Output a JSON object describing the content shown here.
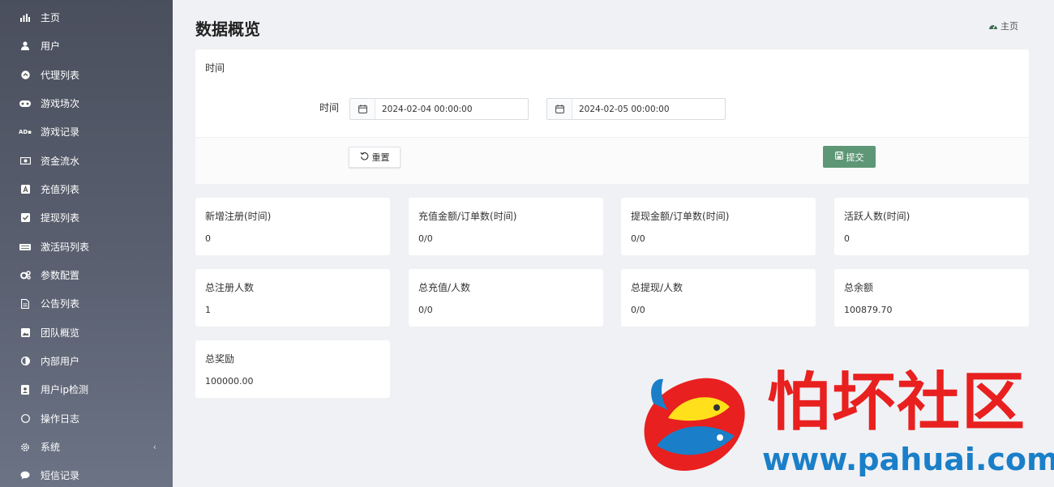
{
  "sidebar": {
    "items": [
      {
        "label": "主页",
        "icon": "bar-chart-icon"
      },
      {
        "label": "用户",
        "icon": "user-icon"
      },
      {
        "label": "代理列表",
        "icon": "circle-arrow-icon"
      },
      {
        "label": "游戏场次",
        "icon": "gamepad-icon"
      },
      {
        "label": "游戏记录",
        "icon": "ad-icon"
      },
      {
        "label": "资金流水",
        "icon": "money-icon"
      },
      {
        "label": "充值列表",
        "icon": "a-box-icon"
      },
      {
        "label": "提现列表",
        "icon": "check-square-icon"
      },
      {
        "label": "激活码列表",
        "icon": "keyboard-icon"
      },
      {
        "label": "参数配置",
        "icon": "gears-icon"
      },
      {
        "label": "公告列表",
        "icon": "file-text-icon"
      },
      {
        "label": "团队概览",
        "icon": "image-icon"
      },
      {
        "label": "内部用户",
        "icon": "half-circle-icon"
      },
      {
        "label": "用户ip检测",
        "icon": "id-card-icon"
      },
      {
        "label": "操作日志",
        "icon": "circle-outline-icon"
      },
      {
        "label": "系统",
        "icon": "gear-icon",
        "chevron": "‹"
      },
      {
        "label": "短信记录",
        "icon": "comment-icon"
      }
    ]
  },
  "header": {
    "title": "数据概览",
    "breadcrumb": "主页"
  },
  "filter": {
    "panel_title": "时间",
    "time_label": "时间",
    "start": "2024-02-04 00:00:00",
    "end": "2024-02-05 00:00:00",
    "reset_label": "重置",
    "submit_label": "提交"
  },
  "stats": [
    {
      "title": "新增注册(时间)",
      "value": "0"
    },
    {
      "title": "充值金额/订单数(时间)",
      "value": "0/0"
    },
    {
      "title": "提现金额/订单数(时间)",
      "value": "0/0"
    },
    {
      "title": "活跃人数(时间)",
      "value": "0"
    },
    {
      "title": "总注册人数",
      "value": "1"
    },
    {
      "title": "总充值/人数",
      "value": "0/0"
    },
    {
      "title": "总提现/人数",
      "value": "0/0"
    },
    {
      "title": "总余额",
      "value": "100879.70"
    },
    {
      "title": "总奖励",
      "value": "100000.00"
    }
  ],
  "watermark": {
    "name": "怕坏社区",
    "url": "www.pahuai.com"
  },
  "colors": {
    "submit": "#5e9776",
    "watermark_red": "#e8201f",
    "watermark_blue": "#1a7fc8"
  }
}
